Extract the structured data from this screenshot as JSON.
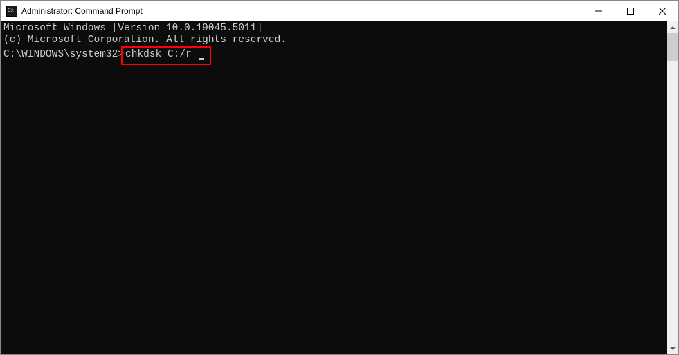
{
  "window": {
    "title": "Administrator: Command Prompt"
  },
  "terminal": {
    "line1": "Microsoft Windows [Version 10.0.19045.5011]",
    "line2": "(c) Microsoft Corporation. All rights reserved.",
    "blank": "",
    "prompt_path": "C:\\WINDOWS\\system32>",
    "command": "chkdsk C:/r"
  },
  "highlight": {
    "color": "#ff0000"
  }
}
